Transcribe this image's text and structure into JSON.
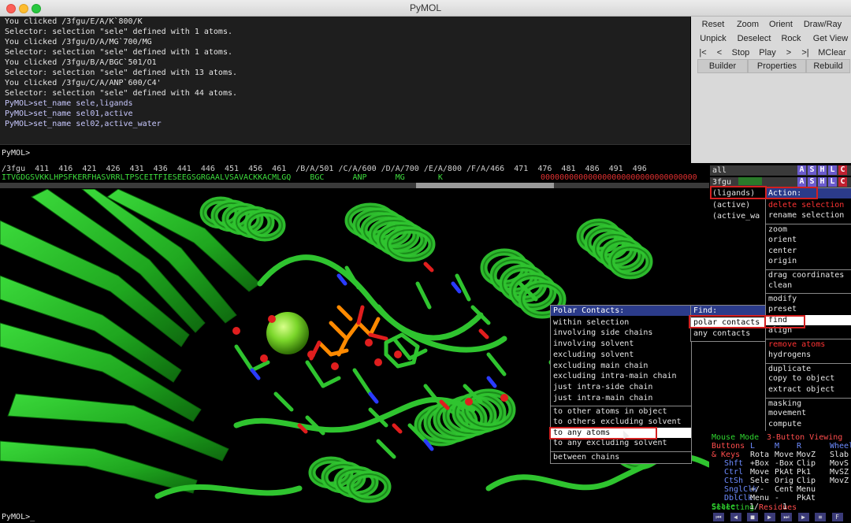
{
  "window": {
    "title": "PyMOL"
  },
  "log": {
    "lines": [
      {
        "text": "You clicked /3fgu/E/A/K`800/K",
        "cmd": false
      },
      {
        "text": "Selector: selection \"sele\" defined with 1 atoms.",
        "cmd": false
      },
      {
        "text": "You clicked /3fgu/D/A/MG`700/MG",
        "cmd": false
      },
      {
        "text": "Selector: selection \"sele\" defined with 1 atoms.",
        "cmd": false
      },
      {
        "text": "You clicked /3fgu/B/A/BGC`501/O1",
        "cmd": false
      },
      {
        "text": "Selector: selection \"sele\" defined with 13 atoms.",
        "cmd": false
      },
      {
        "text": "You clicked /3fgu/C/A/ANP`600/C4'",
        "cmd": false
      },
      {
        "text": "Selector: selection \"sele\" defined with 44 atoms.",
        "cmd": false
      },
      {
        "text": "PyMOL>set_name sele,ligands",
        "cmd": true
      },
      {
        "text": "PyMOL>set_name sel01,active",
        "cmd": true
      },
      {
        "text": "PyMOL>set_name sel02,active_water",
        "cmd": true
      }
    ],
    "prompt": "PyMOL>"
  },
  "controls": {
    "row1": [
      "Reset",
      "Zoom",
      "Orient",
      "Draw/Ray"
    ],
    "row2": [
      "Unpick",
      "Deselect",
      "Rock",
      "Get View"
    ],
    "row3": [
      "|<",
      "<",
      "Stop",
      "Play",
      ">",
      ">|",
      "MClear"
    ],
    "row4": [
      "Builder",
      "Properties",
      "Rebuild"
    ]
  },
  "sequence": {
    "numbers": "/3fgu  411  416  421  426  431  436  441  446  451  456  461  /B/A/501 /C/A/600 /D/A/700 /E/A/800 /F/A/466  471  476  481  486  491  496",
    "residues": "ITVGDGSVKKLHPSFKERFHASVRRLTPSCEITFIESEEGSGRGAALVSAVACKKACMLGQ    BGC      ANP      MG       K",
    "tail": "000000000000000000000000000000000"
  },
  "objects": [
    {
      "name": "all"
    },
    {
      "name": "3fgu"
    },
    {
      "name": "(ligands)"
    },
    {
      "name": "(active)"
    },
    {
      "name": "(active_wa"
    }
  ],
  "ashl": [
    "A",
    "S",
    "H",
    "L",
    "C"
  ],
  "action_menu": {
    "header": "Action:",
    "items": [
      {
        "label": "delete selection",
        "style": "red"
      },
      {
        "label": "rename selection",
        "style": ""
      },
      {
        "label": "zoom",
        "style": "sep"
      },
      {
        "label": "orient",
        "style": ""
      },
      {
        "label": "center",
        "style": ""
      },
      {
        "label": "origin",
        "style": ""
      },
      {
        "label": "drag coordinates",
        "style": "sep"
      },
      {
        "label": "clean",
        "style": ""
      },
      {
        "label": "modify",
        "style": "sep"
      },
      {
        "label": "preset",
        "style": ""
      },
      {
        "label": "find",
        "style": "sel"
      },
      {
        "label": "align",
        "style": ""
      },
      {
        "label": "remove atoms",
        "style": "red sep"
      },
      {
        "label": "hydrogens",
        "style": ""
      },
      {
        "label": "duplicate",
        "style": "sep"
      },
      {
        "label": "copy to object",
        "style": ""
      },
      {
        "label": "extract object",
        "style": ""
      },
      {
        "label": "masking",
        "style": "sep"
      },
      {
        "label": "movement",
        "style": ""
      },
      {
        "label": "compute",
        "style": ""
      }
    ]
  },
  "find_menu": {
    "header": "Find:",
    "items": [
      {
        "label": "polar contacts",
        "style": "sel"
      },
      {
        "label": "any contacts",
        "style": ""
      }
    ]
  },
  "polar_menu": {
    "header": "Polar Contacts:",
    "items": [
      {
        "label": "within selection",
        "style": ""
      },
      {
        "label": "involving side chains",
        "style": ""
      },
      {
        "label": "involving solvent",
        "style": ""
      },
      {
        "label": "excluding solvent",
        "style": ""
      },
      {
        "label": "excluding main chain",
        "style": ""
      },
      {
        "label": "excluding intra-main chain",
        "style": ""
      },
      {
        "label": "just intra-side chain",
        "style": ""
      },
      {
        "label": "just intra-main chain",
        "style": ""
      },
      {
        "label": "to other atoms in object",
        "style": "sep"
      },
      {
        "label": "to others excluding solvent",
        "style": ""
      },
      {
        "label": "to any atoms",
        "style": "sel"
      },
      {
        "label": "to any excluding solvent",
        "style": ""
      },
      {
        "label": "between chains",
        "style": "sep"
      }
    ]
  },
  "mouse_mode": {
    "title": "Mouse Mode",
    "mode": "3-Button Viewing",
    "row_buttons": [
      "Buttons",
      "L",
      "M",
      "R",
      "Wheel"
    ],
    "row_keys": [
      "& Keys",
      "Rota",
      "Move",
      "MovZ",
      "Slab"
    ],
    "row_shft": [
      "Shft",
      "+Box",
      "-Box",
      "Clip",
      "MovS"
    ],
    "row_ctrl": [
      "Ctrl",
      "Move",
      "PkAt",
      "Pk1",
      "MvSZ"
    ],
    "row_ctsh": [
      "CtSh",
      "Sele",
      "Orig",
      "Clip",
      "MovZ"
    ],
    "row_sngl": [
      "SnglClk",
      "+/-",
      "Cent",
      "Menu",
      ""
    ],
    "row_dbl": [
      "DblClk",
      "Menu",
      "-",
      "PkAt",
      ""
    ],
    "selecting_label": "Selecting",
    "selecting_value": "Residues",
    "state_label": "State",
    "state_value": "1/",
    "state_total": "1"
  },
  "bottom_prompt": "PyMOL>_",
  "colors": {
    "protein": "#2fc42f",
    "ligand": "#ff8a00",
    "oxygen": "#e01e1e",
    "nitrogen": "#2a3bff",
    "magnesium": "#7ad62a",
    "menu_header": "#2b3b8a",
    "highlight_box": "#d32020"
  }
}
